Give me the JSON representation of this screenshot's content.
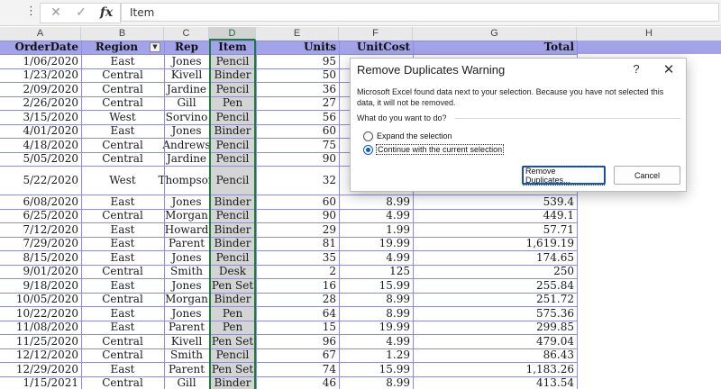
{
  "formula_bar": {
    "more_icon": "more-vertical-icon",
    "cancel_icon": "x-icon",
    "confirm_icon": "check-icon",
    "fx_label": "fx",
    "value": "Item"
  },
  "columns": [
    "A",
    "B",
    "C",
    "D",
    "E",
    "F",
    "G",
    "H"
  ],
  "selected_column": "D",
  "table": {
    "headers": [
      "OrderDate",
      "Region",
      "Rep",
      "Item",
      "Units",
      "UnitCost",
      "Total"
    ],
    "filter_icon": "dropdown-arrow-icon",
    "rows": [
      {
        "date": "1/06/2020",
        "region": "East",
        "rep": "Jones",
        "item": "Pencil",
        "units": "95",
        "unitcost": "",
        "total": ""
      },
      {
        "date": "1/23/2020",
        "region": "Central",
        "rep": "Kivell",
        "item": "Binder",
        "units": "50",
        "unitcost": "",
        "total": ""
      },
      {
        "date": "2/09/2020",
        "region": "Central",
        "rep": "Jardine",
        "item": "Pencil",
        "units": "36",
        "unitcost": "",
        "total": ""
      },
      {
        "date": "2/26/2020",
        "region": "Central",
        "rep": "Gill",
        "item": "Pen",
        "units": "27",
        "unitcost": "",
        "total": ""
      },
      {
        "date": "3/15/2020",
        "region": "West",
        "rep": "Sorvino",
        "item": "Pencil",
        "units": "56",
        "unitcost": "",
        "total": ""
      },
      {
        "date": "4/01/2020",
        "region": "East",
        "rep": "Jones",
        "item": "Binder",
        "units": "60",
        "unitcost": "",
        "total": ""
      },
      {
        "date": "4/18/2020",
        "region": "Central",
        "rep": "Andrews",
        "item": "Pencil",
        "units": "75",
        "unitcost": "",
        "total": ""
      },
      {
        "date": "5/05/2020",
        "region": "Central",
        "rep": "Jardine",
        "item": "Pencil",
        "units": "90",
        "unitcost": "",
        "total": ""
      },
      {
        "date": "5/22/2020",
        "region": "West",
        "rep": "Thompson",
        "item": "Pencil",
        "units": "32",
        "unitcost": "",
        "total": ""
      },
      {
        "date": "6/08/2020",
        "region": "East",
        "rep": "Jones",
        "item": "Binder",
        "units": "60",
        "unitcost": "8.99",
        "total": "539.4"
      },
      {
        "date": "6/25/2020",
        "region": "Central",
        "rep": "Morgan",
        "item": "Pencil",
        "units": "90",
        "unitcost": "4.99",
        "total": "449.1"
      },
      {
        "date": "7/12/2020",
        "region": "East",
        "rep": "Howard",
        "item": "Binder",
        "units": "29",
        "unitcost": "1.99",
        "total": "57.71"
      },
      {
        "date": "7/29/2020",
        "region": "East",
        "rep": "Parent",
        "item": "Binder",
        "units": "81",
        "unitcost": "19.99",
        "total": "1,619.19"
      },
      {
        "date": "8/15/2020",
        "region": "East",
        "rep": "Jones",
        "item": "Pencil",
        "units": "35",
        "unitcost": "4.99",
        "total": "174.65"
      },
      {
        "date": "9/01/2020",
        "region": "Central",
        "rep": "Smith",
        "item": "Desk",
        "units": "2",
        "unitcost": "125",
        "total": "250"
      },
      {
        "date": "9/18/2020",
        "region": "East",
        "rep": "Jones",
        "item": "Pen Set",
        "units": "16",
        "unitcost": "15.99",
        "total": "255.84"
      },
      {
        "date": "10/05/2020",
        "region": "Central",
        "rep": "Morgan",
        "item": "Binder",
        "units": "28",
        "unitcost": "8.99",
        "total": "251.72"
      },
      {
        "date": "10/22/2020",
        "region": "East",
        "rep": "Jones",
        "item": "Pen",
        "units": "64",
        "unitcost": "8.99",
        "total": "575.36"
      },
      {
        "date": "11/08/2020",
        "region": "East",
        "rep": "Parent",
        "item": "Pen",
        "units": "15",
        "unitcost": "19.99",
        "total": "299.85"
      },
      {
        "date": "11/25/2020",
        "region": "Central",
        "rep": "Kivell",
        "item": "Pen Set",
        "units": "96",
        "unitcost": "4.99",
        "total": "479.04"
      },
      {
        "date": "12/12/2020",
        "region": "Central",
        "rep": "Smith",
        "item": "Pencil",
        "units": "67",
        "unitcost": "1.29",
        "total": "86.43"
      },
      {
        "date": "12/29/2020",
        "region": "East",
        "rep": "Parent",
        "item": "Pen Set",
        "units": "74",
        "unitcost": "15.99",
        "total": "1,183.26"
      },
      {
        "date": "1/15/2021",
        "region": "Central",
        "rep": "Gill",
        "item": "Binder",
        "units": "46",
        "unitcost": "8.99",
        "total": "413.54"
      }
    ]
  },
  "dialog": {
    "title": "Remove Duplicates Warning",
    "help_label": "?",
    "close_icon": "close-icon",
    "message": "Microsoft Excel found data next to your selection. Because you have not selected this data, it will not be removed.",
    "question": "What do you want to do?",
    "options": [
      {
        "label": "Expand the selection",
        "selected": false
      },
      {
        "label": "Continue with the current selection",
        "selected": true
      }
    ],
    "primary_button": "Remove Duplicates...",
    "cancel_button": "Cancel"
  },
  "colors": {
    "header_fill": "#a3a3ea",
    "gridline": "#8c8ce0",
    "selection_green": "#1f7a42",
    "selected_item_fill": "#d4d4d4",
    "dialog_accent": "#0b5cc9"
  }
}
